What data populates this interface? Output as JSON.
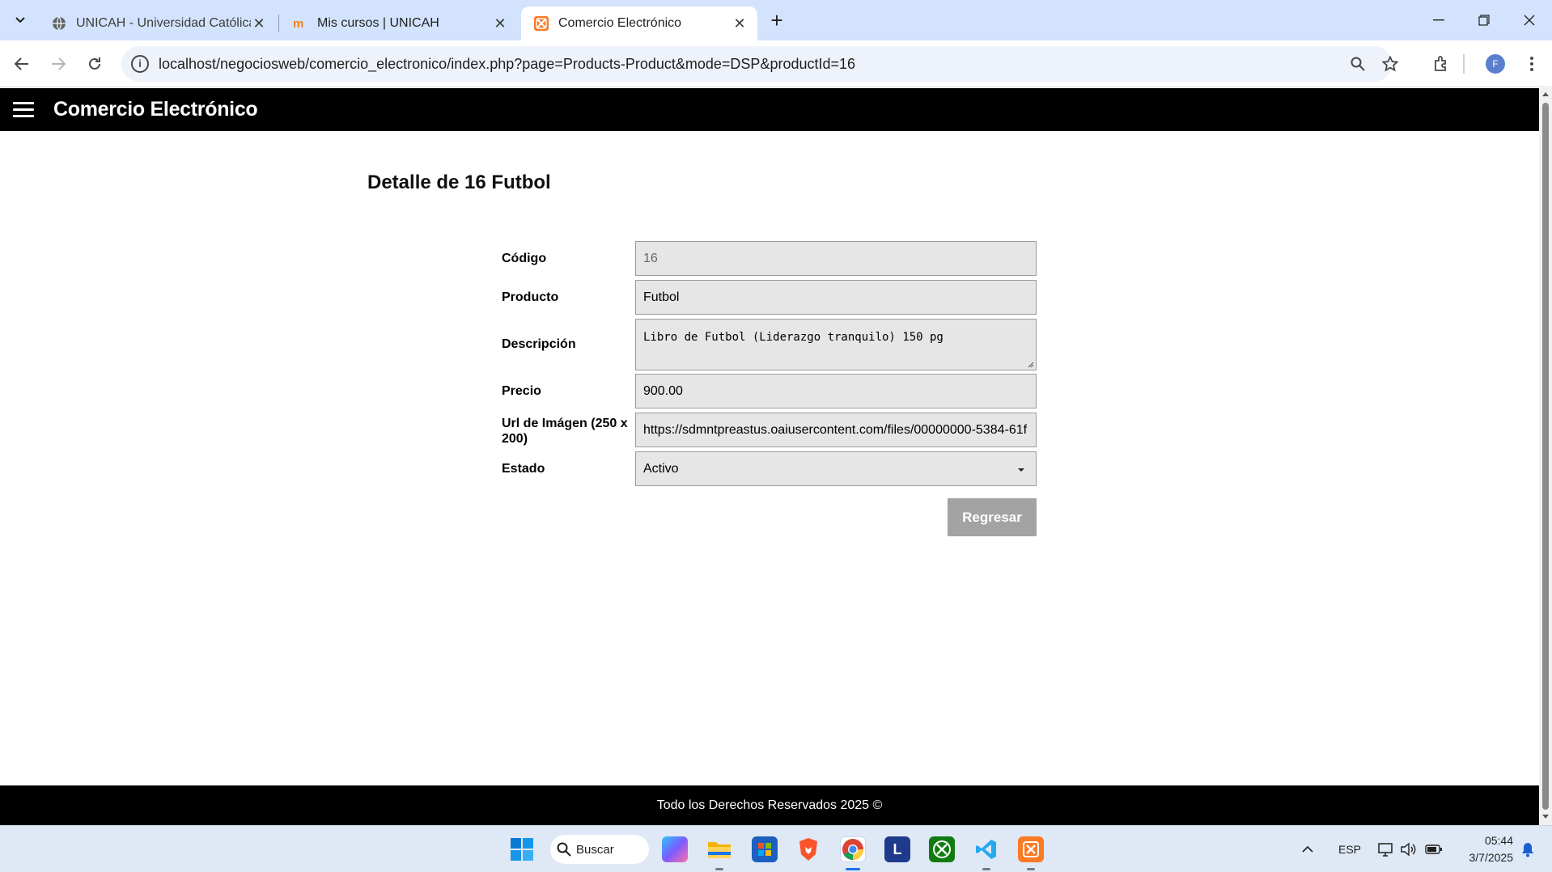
{
  "browser": {
    "tabs": [
      {
        "title": "UNICAH - Universidad Católica",
        "icon": "globe-icon",
        "active": false
      },
      {
        "title": "Mis cursos | UNICAH",
        "icon": "moodle-icon",
        "active": false
      },
      {
        "title": "Comercio Electrónico",
        "icon": "xampp-icon",
        "active": true
      }
    ],
    "url": "localhost/negociosweb/comercio_electronico/index.php?page=Products-Product&mode=DSP&productId=16",
    "profile_initial": "F"
  },
  "app": {
    "brand": "Comercio Electrónico"
  },
  "page": {
    "title": "Detalle de 16 Futbol",
    "form": {
      "codigo_label": "Código",
      "codigo_value": "16",
      "producto_label": "Producto",
      "producto_value": "Futbol",
      "descripcion_label": "Descripción",
      "descripcion_value": "Libro de Futbol (Liderazgo tranquilo) 150 pg",
      "precio_label": "Precio",
      "precio_value": "900.00",
      "url_label": "Url de Imágen (250 x 200)",
      "url_value": "https://sdmntpreastus.oaiusercontent.com/files/00000000-5384-61f",
      "estado_label": "Estado",
      "estado_value": "Activo"
    },
    "back_button": "Regresar"
  },
  "footer": {
    "text": "Todo los Derechos Reservados 2025 ©"
  },
  "taskbar": {
    "search_label": "Buscar",
    "language": "ESP",
    "time": "05:44",
    "date": "3/7/2025"
  },
  "colors": {
    "appbar": "#000000",
    "field_bg": "#e6e6e6",
    "button_bg": "#a3a3a3",
    "tabstrip": "#d3e3fd"
  }
}
